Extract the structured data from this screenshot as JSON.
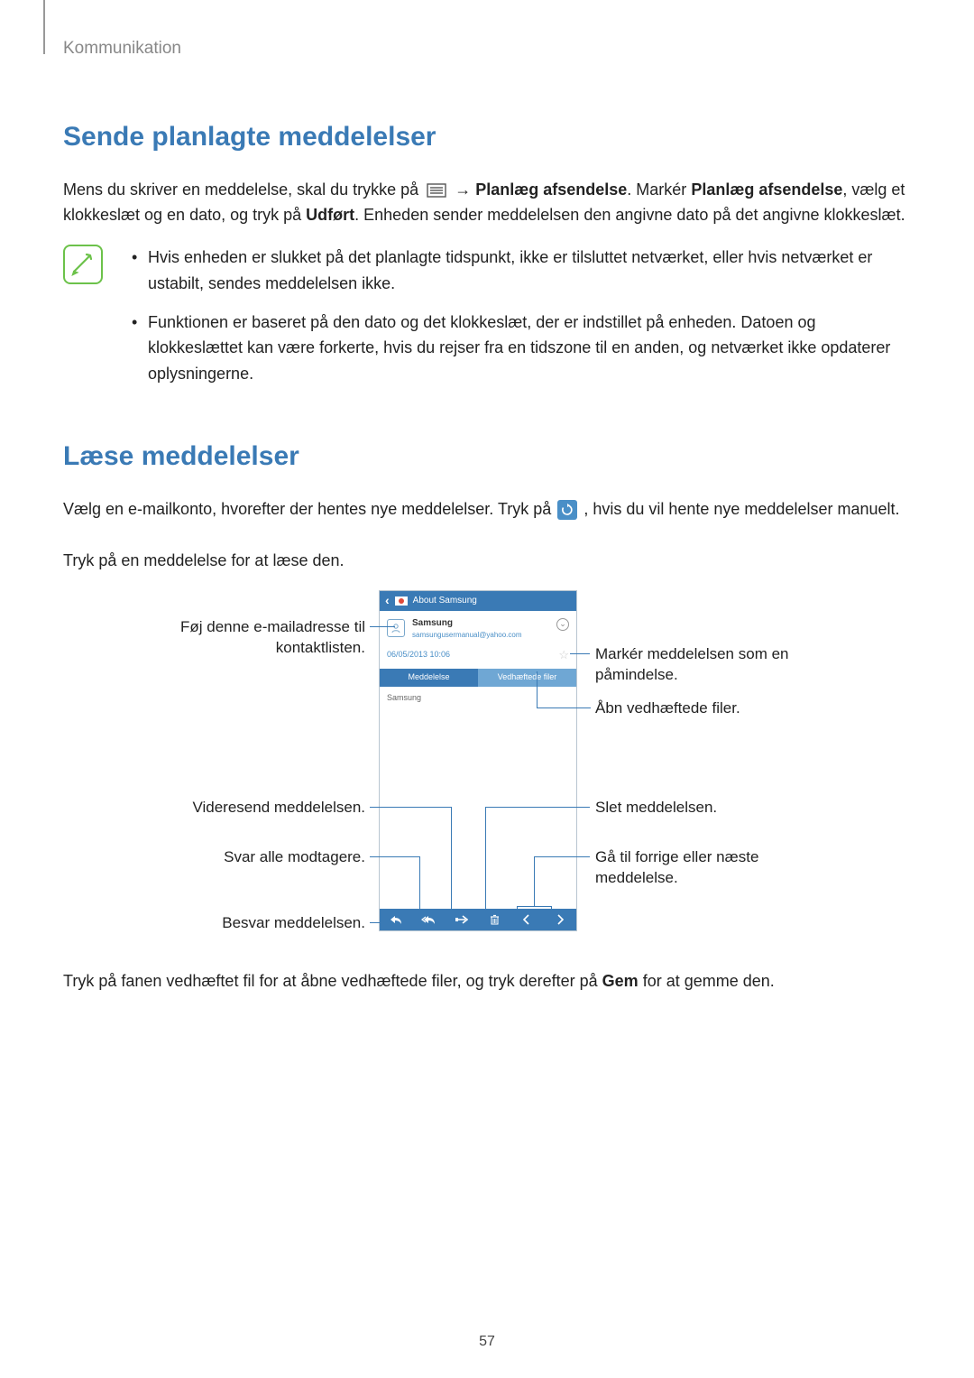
{
  "breadcrumb": "Kommunikation",
  "section1": {
    "heading": "Sende planlagte meddelelser",
    "p1_a": "Mens du skriver en meddelelse, skal du trykke på ",
    "p1_arrow": " → ",
    "p1_bold1": "Planlæg afsendelse",
    "p1_mid1": ". Markér ",
    "p1_bold2": "Planlæg afsendelse",
    "p1_mid2": ", vælg et klokkeslæt og en dato, og tryk på ",
    "p1_bold3": "Udført",
    "p1_end": ". Enheden sender meddelelsen den angivne dato på det angivne klokkeslæt.",
    "note1": "Hvis enheden er slukket på det planlagte tidspunkt, ikke er tilsluttet netværket, eller hvis netværket er ustabilt, sendes meddelelsen ikke.",
    "note2": "Funktionen er baseret på den dato og det klokkeslæt, der er indstillet på enheden. Datoen og klokkeslættet kan være forkerte, hvis du rejser fra en tidszone til en anden, og netværket ikke opdaterer oplysningerne."
  },
  "section2": {
    "heading": "Læse meddelelser",
    "p1_a": "Vælg en e-mailkonto, hvorefter der hentes nye meddelelser. Tryk på ",
    "p1_b": ", hvis du vil hente nye meddelelser manuelt.",
    "p2": "Tryk på en meddelelse for at læse den."
  },
  "callouts": {
    "addContact": "Føj denne e-mailadresse til kontaktlisten.",
    "forward": "Videresend meddelelsen.",
    "replyAll": "Svar alle modtagere.",
    "reply": "Besvar meddelelsen.",
    "markReminder": "Markér meddelelsen som en påmindelse.",
    "openAttach": "Åbn vedhæftede filer.",
    "delete": "Slet meddelelsen.",
    "prevNext": "Gå til forrige eller næste meddelelse."
  },
  "phone": {
    "title": "About Samsung",
    "sender": "Samsung",
    "address": "samsungusermanual@yahoo.com",
    "datetime": "06/05/2013 10:06",
    "tab1": "Meddelelse",
    "tab2": "Vedhæftede filer",
    "body": "Samsung"
  },
  "footer": {
    "p_a": "Tryk på fanen vedhæftet fil for at åbne vedhæftede filer, og tryk derefter på ",
    "p_bold": "Gem",
    "p_b": " for at gemme den."
  },
  "pageNumber": "57"
}
